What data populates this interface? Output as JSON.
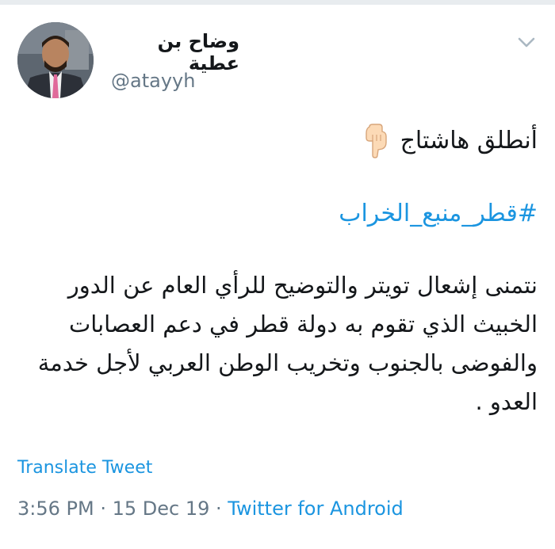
{
  "colors": {
    "link": "#1b95e0",
    "secondary_text": "#657786",
    "primary_text": "#14171a"
  },
  "author": {
    "display_name": "وضاح بن عطية",
    "handle": "@atayyh"
  },
  "header": {
    "menu_icon": "chevron-down-icon"
  },
  "tweet": {
    "line1": "أنطلق هاشتاج",
    "line1_emoji": "pointing-down-emoji",
    "hashtag": "#قطر_منبع_الخراب",
    "body": "نتمنى إشعال تويتر والتوضيح للرأي العام عن الدور الخبيث الذي تقوم به دولة قطر في دعم العصابات والفوضى بالجنوب وتخريب الوطن العربي لأجل خدمة العدو ."
  },
  "translate_label": "Translate Tweet",
  "meta": {
    "time": "3:56 PM",
    "date": "15 Dec 19",
    "separator": " · ",
    "source": "Twitter for Android"
  }
}
